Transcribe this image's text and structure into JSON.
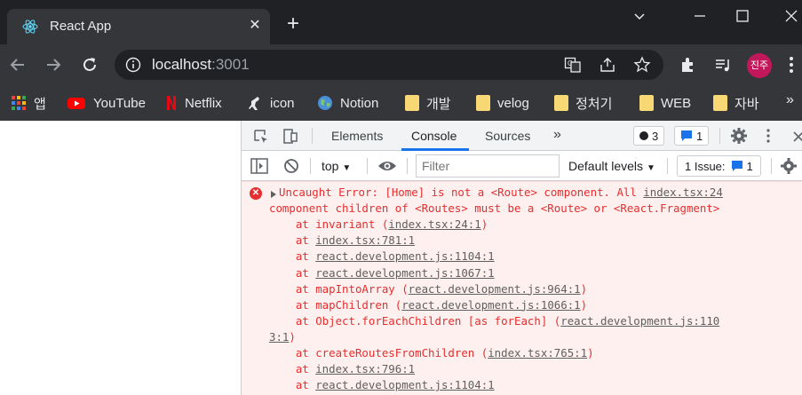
{
  "tab": {
    "title": "React App",
    "close": "✕"
  },
  "newtab": "+",
  "omnibox": {
    "host": "localhost",
    "port": ":3001"
  },
  "profile": {
    "initials": "진주"
  },
  "bookmarks": [
    {
      "label": "앱",
      "icon": "apps-icon"
    },
    {
      "label": "YouTube",
      "icon": "youtube-icon"
    },
    {
      "label": "Netflix",
      "icon": "netflix-icon"
    },
    {
      "label": "icon",
      "icon": "kangaroo-icon"
    },
    {
      "label": "Notion",
      "icon": "globe-icon"
    },
    {
      "label": "개발",
      "icon": "folder-icon"
    },
    {
      "label": "velog",
      "icon": "folder-icon"
    },
    {
      "label": "정처기",
      "icon": "folder-icon"
    },
    {
      "label": "WEB",
      "icon": "folder-icon"
    },
    {
      "label": "자바",
      "icon": "folder-icon"
    }
  ],
  "bookmarks_more": "»",
  "devtools": {
    "tabs": [
      "Elements",
      "Console",
      "Sources"
    ],
    "more": "»",
    "error_count": "3",
    "message_count": "1",
    "context": "top",
    "filter_placeholder": "Filter",
    "levels": "Default levels",
    "issues_label": "1 Issue:",
    "issues_count": "1"
  },
  "console": {
    "lines": [
      {
        "text": "Uncaught Error: [Home] is not a <Route> component. All ",
        "link": "index.tsx:24",
        "right": true
      },
      {
        "text": "component children of <Routes> must be a <Route> or <React.Fragment>"
      },
      {
        "pre": "    at invariant (",
        "link": "index.tsx:24:1",
        "post": ")"
      },
      {
        "pre": "    at ",
        "link": "index.tsx:781:1",
        "post": ""
      },
      {
        "pre": "    at ",
        "link": "react.development.js:1104:1",
        "post": ""
      },
      {
        "pre": "    at ",
        "link": "react.development.js:1067:1",
        "post": ""
      },
      {
        "pre": "    at mapIntoArray (",
        "link": "react.development.js:964:1",
        "post": ")"
      },
      {
        "pre": "    at mapChildren (",
        "link": "react.development.js:1066:1",
        "post": ")"
      },
      {
        "pre": "    at Object.forEachChildren [as forEach] (",
        "link": "react.development.js:110",
        "post": ""
      },
      {
        "pre": "",
        "link": "3:1",
        "post": ")"
      },
      {
        "pre": "    at createRoutesFromChildren (",
        "link": "index.tsx:765:1",
        "post": ")"
      },
      {
        "pre": "    at ",
        "link": "index.tsx:796:1",
        "post": ""
      },
      {
        "pre": "    at ",
        "link": "react.development.js:1104:1",
        "post": ""
      }
    ]
  },
  "colors": {
    "error": "#e62e2e",
    "accent": "#1a73e8",
    "chrome_dark": "#202124",
    "chrome_mid": "#35363a"
  }
}
